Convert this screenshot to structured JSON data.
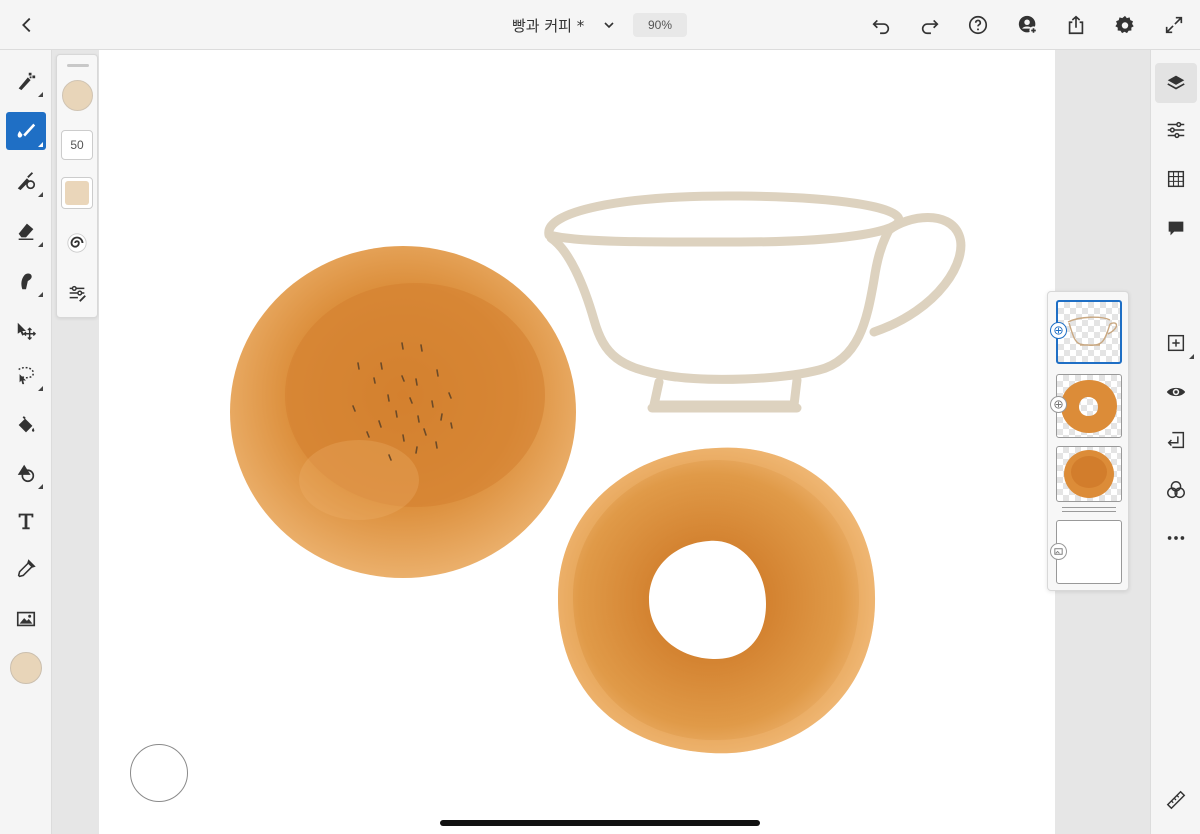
{
  "app": {
    "document_title": "빵과 커피 *",
    "zoom": "90%"
  },
  "brush_panel": {
    "size": "50",
    "color": "#e8d5b9"
  },
  "colors": {
    "active_tool": "#1f6fc5",
    "current_color": "#e8d5b9",
    "bread": "#e6a24e",
    "cup_outline": "#ddd2bf"
  },
  "left_tools": [
    "pixel-brush-icon",
    "live-brush-icon",
    "vector-brush-icon",
    "eraser-icon",
    "smudge-icon",
    "transform-icon",
    "lasso-selection-icon",
    "fill-icon",
    "shapes-icon",
    "type-icon",
    "eyedropper-icon",
    "image-icon"
  ],
  "right_tools": [
    "layers-icon",
    "layer-properties-icon",
    "grid-icon",
    "comments-icon",
    "add-layer-icon",
    "visibility-icon",
    "merge-down-icon",
    "blend-icon",
    "more-icon",
    "ruler-icon"
  ],
  "layers": [
    {
      "name": "cup",
      "selected": true
    },
    {
      "name": "bagel",
      "selected": false
    },
    {
      "name": "bun",
      "selected": false
    },
    {
      "name": "background",
      "selected": false
    }
  ]
}
